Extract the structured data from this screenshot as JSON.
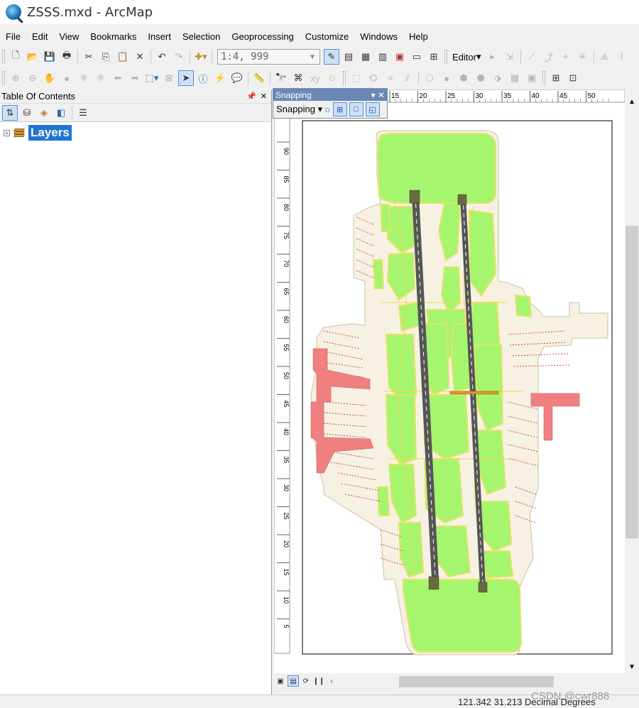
{
  "window": {
    "title": "ZSSS.mxd - ArcMap"
  },
  "menu": [
    "File",
    "Edit",
    "View",
    "Bookmarks",
    "Insert",
    "Selection",
    "Geoprocessing",
    "Customize",
    "Windows",
    "Help"
  ],
  "toolbar": {
    "scale_value": "1:4, 999",
    "editor_label": "Editor"
  },
  "toc": {
    "title": "Table Of Contents",
    "root_layer": "Layers"
  },
  "snapping": {
    "title": "Snapping",
    "menu_label": "Snapping"
  },
  "ruler": {
    "top_ticks": [
      "15",
      "20",
      "25",
      "30",
      "35",
      "40",
      "45",
      "50"
    ],
    "left_ticks": [
      "90",
      "85",
      "80",
      "75",
      "70",
      "65",
      "60",
      "55",
      "50",
      "45",
      "40",
      "35",
      "30",
      "25",
      "20",
      "15",
      "10",
      "5"
    ]
  },
  "status": {
    "coordinates": "121.342  31.213 Decimal Degrees"
  },
  "watermark": "CSDN @cwr888",
  "icons": [
    "search-icon",
    "new-doc-icon",
    "open-icon",
    "save-icon",
    "print-icon",
    "cut-icon",
    "copy-icon",
    "paste-icon",
    "delete-icon",
    "undo-icon",
    "redo-icon",
    "add-data-icon",
    "editor-toolbar-icon",
    "zoom-in-icon",
    "zoom-out-icon",
    "pan-icon",
    "globe-icon",
    "select-arrow-icon",
    "identify-icon",
    "find-icon",
    "layers-icon"
  ],
  "colors": {
    "grass": "#a6f56f",
    "runway": "#555555",
    "terminal": "#f08080",
    "apron": "#f6f1e2",
    "selection": "#1f74d4"
  }
}
